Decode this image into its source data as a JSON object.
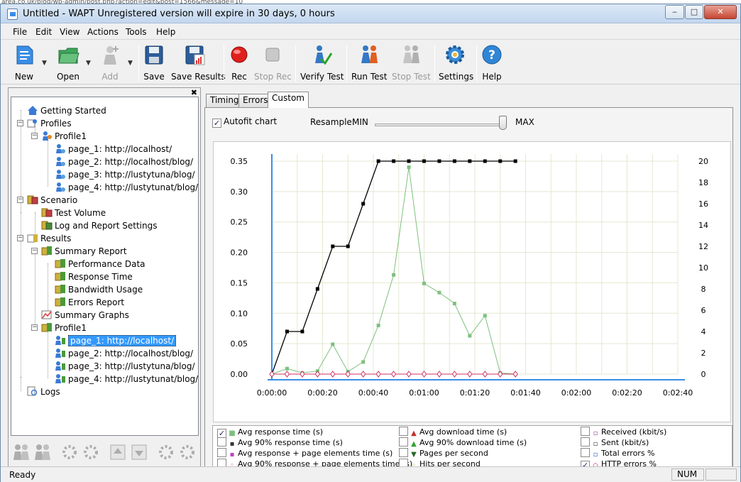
{
  "browser_url_fragment": "area.co.uk/blog/wp-admin/post.php?action=edit&post=1566&message=10",
  "window": {
    "title": "Untitled - WAPT Unregistered version will expire in 30 days, 0 hours"
  },
  "menu": [
    "File",
    "Edit",
    "View",
    "Actions",
    "Tools",
    "Help"
  ],
  "toolbar": {
    "new": "New",
    "open": "Open",
    "add": "Add",
    "save": "Save",
    "save_results": "Save Results",
    "rec": "Rec",
    "stop_rec": "Stop Rec",
    "verify_test": "Verify Test",
    "run_test": "Run Test",
    "stop_test": "Stop Test",
    "settings": "Settings",
    "help": "Help"
  },
  "tree": {
    "getting_started": "Getting Started",
    "profiles": "Profiles",
    "profile1": "Profile1",
    "pages": [
      "page_1: http://localhost/",
      "page_2: http://localhost/blog/",
      "page_3: http://lustytuna/blog/",
      "page_4: http://lustytunat/blog/"
    ],
    "scenario": "Scenario",
    "test_volume": "Test Volume",
    "log_report": "Log and Report Settings",
    "results": "Results",
    "summary_report": "Summary Report",
    "performance_data": "Performance Data",
    "response_time": "Response Time",
    "bandwidth_usage": "Bandwidth Usage",
    "errors_report": "Errors Report",
    "summary_graphs": "Summary Graphs",
    "result_profile1": "Profile1",
    "result_pages": [
      "page_1: http://localhost/",
      "page_2: http://localhost/blog/",
      "page_3: http://lustytuna/blog/",
      "page_4: http://lustytunat/blog/"
    ],
    "logs": "Logs"
  },
  "tabs": [
    "Timings",
    "Errors",
    "Custom"
  ],
  "active_tab": "Custom",
  "controls": {
    "autofit": "Autofit chart",
    "autofit_checked": true,
    "resample": "Resample:",
    "min": "MIN",
    "max": "MAX",
    "resample_position": 1.0
  },
  "legend": [
    {
      "label": "Avg response time (s)",
      "checked": true,
      "color": "#7fbf7f",
      "symbol": "■"
    },
    {
      "label": "Avg 90% response time (s)",
      "checked": false,
      "color": "#333333",
      "symbol": "▪"
    },
    {
      "label": "Avg response + page elements time (s)",
      "checked": false,
      "color": "#c040c0",
      "symbol": "▪"
    },
    {
      "label": "Avg 90% response + page elements time (s)",
      "checked": false,
      "color": "#c040c0",
      "symbol": "◦"
    },
    {
      "label": "Avg download time (s)",
      "checked": false,
      "color": "#c03030",
      "symbol": "▲"
    },
    {
      "label": "Avg 90% download time (s)",
      "checked": false,
      "color": "#30a030",
      "symbol": "▲"
    },
    {
      "label": "Pages per second",
      "checked": false,
      "color": "#2a6a2a",
      "symbol": "▼"
    },
    {
      "label": "Hits per second",
      "checked": false,
      "color": "#d0a040",
      "symbol": "◦"
    },
    {
      "label": "Received (kbit/s)",
      "checked": false,
      "color": "#a040a0",
      "symbol": "▫"
    },
    {
      "label": "Sent (kbit/s)",
      "checked": false,
      "color": "#404040",
      "symbol": "▫"
    },
    {
      "label": "Total errors %",
      "checked": false,
      "color": "#3070c0",
      "symbol": "▫"
    },
    {
      "label": "HTTP errors %",
      "checked": true,
      "color": "#d03060",
      "symbol": "◇"
    }
  ],
  "status": {
    "text": "Ready",
    "num": "NUM"
  },
  "chart_data": {
    "type": "line",
    "x_tick_labels": [
      "0:00:00",
      "0:00:20",
      "0:00:40",
      "0:01:00",
      "0:01:20",
      "0:01:40",
      "0:02:00",
      "0:02:20",
      "0:02:40"
    ],
    "y_left_ticks": [
      "0.00",
      "0.05",
      "0.10",
      "0.15",
      "0.20",
      "0.25",
      "0.30",
      "0.35"
    ],
    "y_right_ticks": [
      "0",
      "2",
      "4",
      "6",
      "8",
      "10",
      "12",
      "14",
      "16",
      "18",
      "20"
    ],
    "ylim_left": [
      0,
      0.35
    ],
    "ylim_right": [
      0,
      20
    ],
    "xlim_seconds": [
      0,
      160
    ],
    "grid": true,
    "series": [
      {
        "axis": "right",
        "color": "#000000",
        "marker": "square",
        "x": [
          0,
          6,
          12,
          18,
          24,
          30,
          36,
          42,
          48,
          54,
          60,
          66,
          72,
          78,
          84,
          90,
          96
        ],
        "values": [
          0,
          4,
          4,
          8,
          12,
          12,
          16,
          20,
          20,
          20,
          20,
          20,
          20,
          20,
          20,
          20,
          20
        ]
      },
      {
        "axis": "left",
        "color": "#7fbf7f",
        "marker": "square",
        "x": [
          0,
          6,
          12,
          18,
          24,
          30,
          36,
          42,
          48,
          54,
          60,
          66,
          72,
          78,
          84,
          90,
          96
        ],
        "values": [
          0,
          0.009,
          0.002,
          0.005,
          0.049,
          0.004,
          0.02,
          0.08,
          0.163,
          0.34,
          0.149,
          0.134,
          0.116,
          0.063,
          0.096,
          0.002,
          0
        ]
      },
      {
        "axis": "left",
        "color": "#d03060",
        "marker": "diamond",
        "x": [
          0,
          6,
          12,
          18,
          24,
          30,
          36,
          42,
          48,
          54,
          60,
          66,
          72,
          78,
          84,
          90,
          96
        ],
        "values": [
          0,
          0,
          0,
          0,
          0,
          0,
          0,
          0,
          0,
          0,
          0,
          0,
          0,
          0,
          0,
          0,
          0
        ]
      }
    ]
  }
}
